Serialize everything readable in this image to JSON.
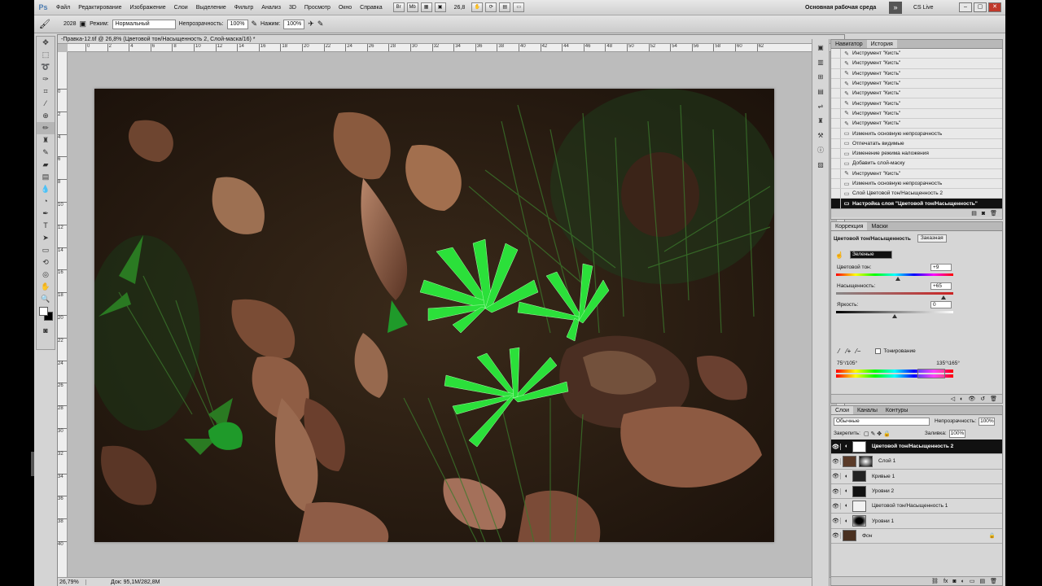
{
  "menubar": {
    "logo": "Ps",
    "items": [
      "Файл",
      "Редактирование",
      "Изображение",
      "Слои",
      "Выделение",
      "Фильтр",
      "Анализ",
      "3D",
      "Просмотр",
      "Окно",
      "Справка"
    ],
    "zoom": "26,8",
    "workspace": "Основная рабочая среда",
    "cs_live": "CS Live"
  },
  "options": {
    "brush_size": "2028",
    "mode_label": "Режим:",
    "mode": "Нормальный",
    "opacity_label": "Непрозрачность:",
    "opacity": "100%",
    "pressure_label": "Нажим:",
    "pressure": "100%"
  },
  "document": {
    "tab": "-Правка-12.tif @ 26,8% (Цветовой тон/Насыщенность 2, Слой-маска/16) *",
    "zoom": "26,79%",
    "info": "Док: 95,1M/282,8M"
  },
  "ruler_h": [
    "0",
    "2",
    "4",
    "6",
    "8",
    "10",
    "12",
    "14",
    "16",
    "18",
    "20",
    "22",
    "24",
    "26",
    "28",
    "30",
    "32",
    "34",
    "36",
    "38",
    "40",
    "42",
    "44",
    "46",
    "48",
    "50",
    "52",
    "54",
    "56",
    "58",
    "60",
    "62"
  ],
  "ruler_v": [
    "0",
    "2",
    "4",
    "6",
    "8",
    "10",
    "12",
    "14",
    "16",
    "18",
    "20",
    "22",
    "24",
    "26",
    "28",
    "30",
    "32",
    "34",
    "36",
    "38",
    "40"
  ],
  "history": {
    "tabs": [
      "Навигатор",
      "История"
    ],
    "items": [
      "Инструмент \"Кисть\"",
      "Инструмент \"Кисть\"",
      "Инструмент \"Кисть\"",
      "Инструмент \"Кисть\"",
      "Инструмент \"Кисть\"",
      "Инструмент \"Кисть\"",
      "Инструмент \"Кисть\"",
      "Инструмент \"Кисть\"",
      "Изменить основную непрозрачность",
      "Отпечатать видимые",
      "Изменение режима наложения",
      "Добавить слой-маску",
      "Инструмент \"Кисть\"",
      "Изменить основную непрозрачность",
      "Слой Цветовой тон/Насыщенность 2",
      "Настройка слоя \"Цветовой тон/Насыщенность\""
    ]
  },
  "adjustments": {
    "tabs": [
      "Коррекция",
      "Маски"
    ],
    "title": "Цветовой тон/Насыщенность",
    "preset": "Заказная",
    "channel": "Зеленые",
    "hue_label": "Цветовой тон:",
    "hue": "+9",
    "sat_label": "Насыщенность:",
    "sat": "+65",
    "light_label": "Яркость:",
    "light": "0",
    "colorize": "Тонирование",
    "range_left": "75°/105°",
    "range_right": "135°\\165°",
    "hue_fraction": 0.53,
    "sat_fraction": 0.92,
    "light_fraction": 0.5
  },
  "layers": {
    "tabs": [
      "Слои",
      "Каналы",
      "Контуры"
    ],
    "mode": "Обычные",
    "opacity_label": "Непрозрачность:",
    "opacity": "100%",
    "lock_label": "Закрепить:",
    "fill_label": "Заливка:",
    "fill": "100%",
    "items": [
      "Цветовой тон/Насыщенность 2",
      "Слой 1",
      "Кривые 1",
      "Уровни 2",
      "Цветовой тон/Насыщенность 1",
      "Уровни 1",
      "Фон"
    ]
  },
  "colors": {
    "accent": "#4a7bb0",
    "selection": "#111111"
  }
}
